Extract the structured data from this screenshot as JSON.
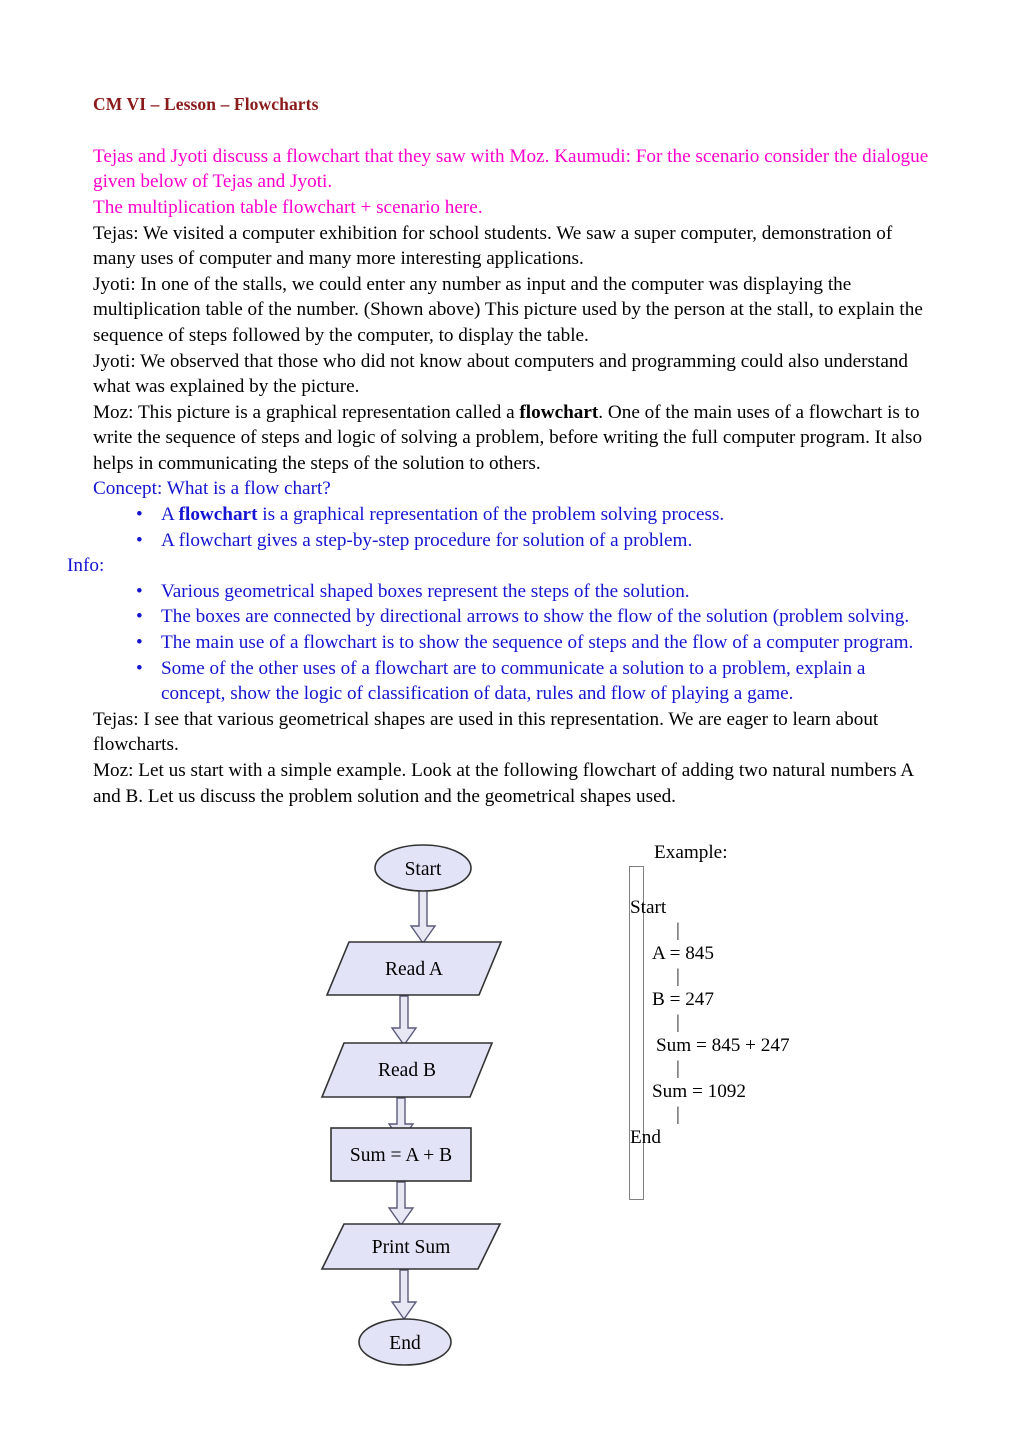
{
  "document": {
    "title": "CM VI – Lesson – Flowcharts",
    "intro": [
      "Tejas and Jyoti discuss a flowchart that they saw with Moz. Kaumudi: For the scenario consider the dialogue given below of Tejas and Jyoti.",
      "The multiplication table flowchart + scenario here."
    ],
    "paragraphs": [
      "Tejas: We visited  a computer exhibition for school students. We saw a super computer, demonstration of many uses of computer and many more interesting applications.",
      "Jyoti: In one of the stalls,  we could enter any number as input and the computer was displaying the multiplication table of the number. (Shown above) This picture used by the person at the stall, to explain the sequence of steps followed by the computer, to display the table.",
      "Jyoti: We observed that those who did not know about computers and programming could also understand what was explained by the picture."
    ],
    "moz_paragraph": {
      "before": "Moz: This picture is a  graphical representation called a ",
      "bold": "flowchart",
      "after": ". One of the main uses of a flowchart is to write the sequence of steps and logic of solving a problem, before writing the full computer program. It also helps in communicating the steps of the solution to others."
    },
    "concept_heading": "Concept: What is a flow chart?",
    "concept_bullets": [
      {
        "before": "A ",
        "bold": "flowchart",
        "after": " is a graphical representation of the problem solving process."
      },
      {
        "before": "A  flowchart gives a step-by-step procedure for solution of a problem.",
        "bold": "",
        "after": ""
      }
    ],
    "info_label": "Info:",
    "info_bullets": [
      "Various geometrical shaped boxes represent the steps of the solution.",
      "The  boxes are  connected  by directional arrows to show the flow of the solution (problem solving.",
      "The main use of a flowchart is to show the sequence of steps and the flow of a computer program.",
      "Some of the other uses of a  flowchart are to communicate a solution to a problem,   explain a concept, show the logic of classification of data, rules and flow of playing a game."
    ],
    "closing_paragraphs": [
      "Tejas:  I see that various geometrical shapes are used in this representation. We are eager to learn about flowcharts.",
      "Moz: Let us start with a simple example. Look at the following flowchart of adding two natural numbers A and B. Let us discuss the problem solution and the geometrical shapes used."
    ],
    "bullet_glyph": "•"
  },
  "flowchart": {
    "nodes": [
      {
        "id": "start",
        "label": "Start",
        "shape": "ellipse"
      },
      {
        "id": "read_a",
        "label": "Read A",
        "shape": "parallelogram"
      },
      {
        "id": "read_b",
        "label": "Read B",
        "shape": "parallelogram"
      },
      {
        "id": "sum",
        "label": "Sum = A + B",
        "shape": "rectangle"
      },
      {
        "id": "print",
        "label": "Print Sum",
        "shape": "parallelogram"
      },
      {
        "id": "end",
        "label": "End",
        "shape": "ellipse"
      }
    ],
    "colors": {
      "fill": "#E3E3F7",
      "stroke": "#333333",
      "arrow_fill": "#E8E8F4",
      "arrow_stroke": "#5A5A7A"
    }
  },
  "example": {
    "title": "Example:",
    "steps": [
      {
        "text": "Start",
        "indent": 0
      },
      {
        "text": "A = 845",
        "indent": 1
      },
      {
        "text": "B = 247",
        "indent": 1
      },
      {
        "text": "Sum = 845 + 247",
        "indent": 2
      },
      {
        "text": "Sum =    1092",
        "indent": 1
      },
      {
        "text": "End",
        "indent": 0
      }
    ],
    "connector": "|"
  }
}
